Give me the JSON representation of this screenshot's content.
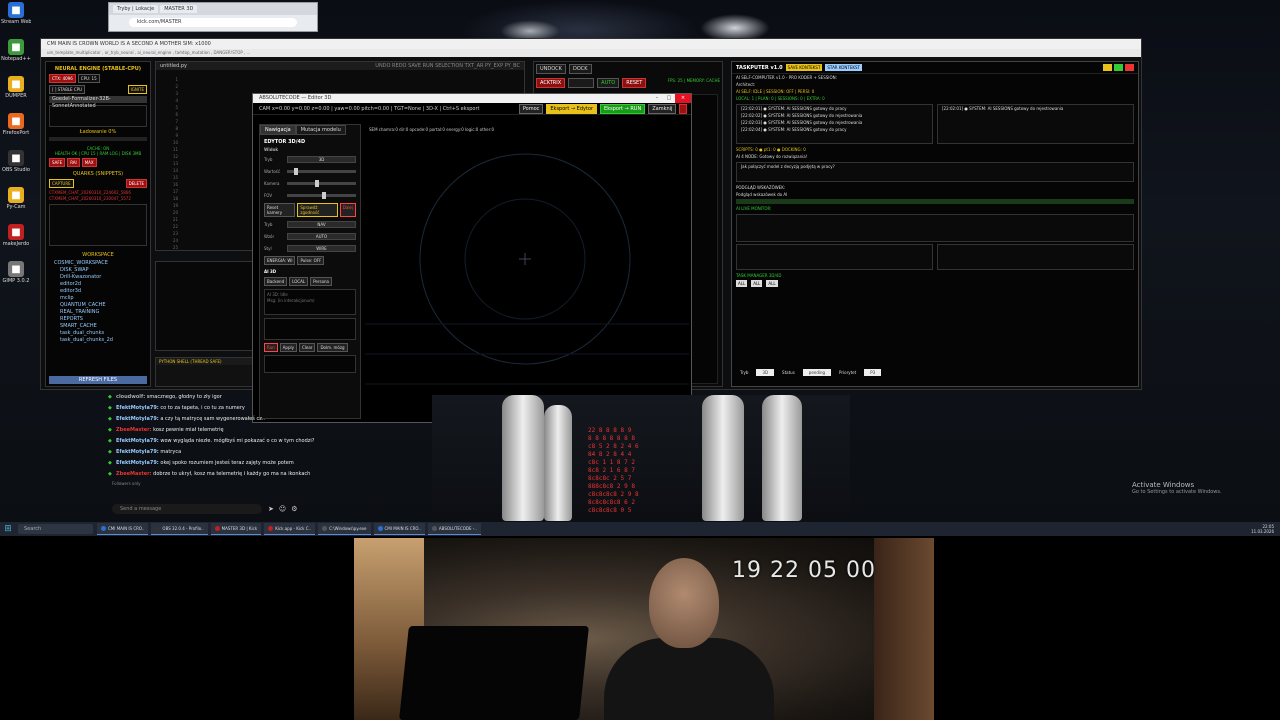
{
  "desktop_icons": [
    {
      "label": "Stream Webcam",
      "icon": "webcam-icon",
      "color": "#2a6fd6"
    },
    {
      "label": "Notepad++",
      "icon": "notepad-icon",
      "color": "#3c9a3c"
    },
    {
      "label": "DUMPER",
      "icon": "folder-icon",
      "color": "#e8b020"
    },
    {
      "label": "FirefoxPort",
      "icon": "firefox-icon",
      "color": "#e86a20"
    },
    {
      "label": "OBS Studio",
      "icon": "obs-icon",
      "color": "#333333"
    },
    {
      "label": "Py-Cam",
      "icon": "folder-icon",
      "color": "#e8b020"
    },
    {
      "label": "makeJerdo",
      "icon": "app-icon",
      "color": "#c02020"
    },
    {
      "label": "GIMP 3.0.2",
      "icon": "gimp-icon",
      "color": "#777777"
    }
  ],
  "browser": {
    "tabs": [
      "Tryby | Lokacje",
      "MASTER 3D"
    ],
    "url": "kick.com/MASTER"
  },
  "ide": {
    "title": "CMI MAIN IS CROWN WORLD IS A SECOND A MOTHER SIM: x1000",
    "subtitle": "um_template_multiplicator  ,  ar_tryb_neural  ,  ai_neural_engine  ,  tamtop_mutation  ,  DANGER!STOP  ,  ..."
  },
  "left_panel": {
    "title": "NEURAL ENGINE (STABLE-CPU)",
    "chips": [
      "CTX: 4096",
      "CPU: 15",
      "[ ] STABLE CPU",
      "IGNITE"
    ],
    "model": "Goedel-Formalizer-32B-SonnetAnnotated",
    "loading": "Ładowanie 0%",
    "cache": "CACHE: ON",
    "health": "HEALTH OK | CPU 15 | RAM LOG | DISK 3MB",
    "buttons": [
      "SAFE",
      "RAI",
      "MAX"
    ],
    "quarks_title": "QUARKS (SNIPPETS)",
    "capture": "CAPTURE",
    "delete": "DELETE",
    "snippets": [
      "CTXMEM_CHAT_20260310_224602_5866",
      "CTXMEM_CHAT_20260310_230047_5572"
    ],
    "workspace_title": "WORKSPACE",
    "tree": [
      "COSMIC_WORKSPACE",
      "DISK_SWAP",
      "Drill-Kwazonator",
      "editor2d",
      "editor3d",
      "mclip",
      "QUANTUM_CACHE",
      "REAL_TRAINING",
      "REPORTS",
      "SMART_CACHE",
      "task_dual_chunks",
      "task_dual_chunks_2d"
    ],
    "refresh": "REFRESH FILES"
  },
  "editor": {
    "tab": "untitled.py",
    "toolbar": "UNDO  REDO  SAVE  RUN  SELECTION  TXT_AR  PY_EXP  PY_BC",
    "lines": [
      "1",
      "2",
      "3",
      "4",
      "5",
      "6",
      "7",
      "8",
      "9",
      "10",
      "11",
      "12",
      "13",
      "14",
      "15",
      "16",
      "17",
      "18",
      "19",
      "20",
      "21",
      "22",
      "23",
      "24",
      "25"
    ],
    "shell_title": "PYTHON SHELL (THREAD SAFE)"
  },
  "right_mid": {
    "undock": "UNDOCK",
    "dock": "DOCK",
    "acktrix": "ACKTRIX",
    "auto": "AUTO",
    "reset": "RESET",
    "status": "FPS: 25 | MEMORY: CACHE"
  },
  "taskputer": {
    "title": "TASKPUTER v1.0",
    "pills": [
      "SAVE KONTEKST",
      "STAR KONTEKST"
    ],
    "header_line": "AI SELF-COMPUTER v1.0 - PRO KODER + SESSION:",
    "arch": "Architect:",
    "l1": "AI SELF: IDLE | SESSION: OFF | PERSI: 0",
    "l2": "LOCAL: 1 | PLAN: 0 | SESSIONS: 0 | EXTRA: 0",
    "log": [
      "[22:02:01] ● SYSTEM: AI SESSIONS gotowy do pracy",
      "[22:02:02] ● SYSTEM: AI SESSIONS gotowy do rejestrowania",
      "[22:02:03] ● SYSTEM: AI SESSIONS gotowy do rejestrowania",
      "[22:02:04] ● SYSTEM: AI SESSIONS gotowy do pracy"
    ],
    "right_log": "[22:02:01] ● SYSTEM: AI SESSIONS gotowy do rejestrowania",
    "q1": "SCRIPTS: 0  ●  pt1: 0  ●  DOCKING: 0",
    "q2": "AI 4 NODE: Gotowy do rozwiązania!",
    "q3": "Jak połączyć model z decyzją podjętą w pracy?",
    "q4": "PODGLĄD WSKAZÓWEK:",
    "q5": "Podgląd wskazówek do AI",
    "monitor": "AI LIVE MONITOR:",
    "bottom_selects": [
      "3D",
      "pending",
      "P3"
    ],
    "bottom_labels": [
      "Tryb",
      "Status",
      "Priorytet"
    ],
    "filters": [
      "ALL",
      "ALL",
      "ALL"
    ],
    "task_manager": "TASK MANAGER 3D/4D"
  },
  "editor3d": {
    "title": "ABSOLUTECODE — Editor 3D",
    "cam": "CAM x=0.00 y=0.00 z=0.00  |  yaw=0.00 pitch=0.00  |  TGT=None  |  3D-X  |  Ctrl+S eksport",
    "buttons": [
      "Pomoc",
      "Eksport → Edytor",
      "Eksport → RUN",
      "Zamknij"
    ],
    "tabs": [
      "Nawigacja",
      "Mutacja modelu"
    ],
    "hud": "SEM  chamra:0  dir:0  opcode:0  portal:0  energy:0  logic:0  other:0",
    "section": "EDYTOR 3D/4D",
    "subsection": "Widok",
    "rows": [
      {
        "k": "Tryb",
        "v": "3D"
      },
      {
        "k": "Wartość",
        "v": ""
      },
      {
        "k": "Kamera",
        "v": ""
      },
      {
        "k": "FOV",
        "v": ""
      }
    ],
    "reset": "Reset kamery",
    "check": "Sprawdź zgodność",
    "more": "Dalej",
    "rows2": [
      {
        "k": "Tryb",
        "v": "NAV"
      },
      {
        "k": "Wzór",
        "v": "AUTO"
      },
      {
        "k": "Styl",
        "v": "WIRE"
      }
    ],
    "energy": "ENERGIA: Wl",
    "pulse": "Pulse: OFF",
    "ai": "AI 3D",
    "backend": "Backend",
    "local": "LOCAL",
    "persona": "Persona",
    "log": "AI 3D: Idle\nMsg: (in interakcjonum)",
    "actions": [
      "Run",
      "Apply",
      "Clear",
      "Dolm. mózg"
    ]
  },
  "chat": [
    {
      "user": "cloudwolf:",
      "text": "smacznego, głodny to zły igor",
      "color": "gray"
    },
    {
      "user": "EfektMotyla79:",
      "text": "co to za tapeta, i co tu za numery",
      "color": "blue"
    },
    {
      "user": "EfektMotyla79:",
      "text": "a czy tą matrycę sam wygenerowałeś cz..",
      "color": "blue"
    },
    {
      "user": "ZbeeMaster:",
      "text": "kosz pewnie miał telemetrię",
      "color": "red"
    },
    {
      "user": "EfektMotyla79:",
      "text": "wow wygląda niezłe. mógłbyś mi pokazać o co w tym chodzi?",
      "color": "blue"
    },
    {
      "user": "EfektMotyla79:",
      "text": "matryca",
      "color": "blue"
    },
    {
      "user": "EfektMotyla79:",
      "text": "okej spoko rozumiem jesteś teraz zajęty może potem",
      "color": "blue"
    },
    {
      "user": "ZbeeMaster:",
      "text": "dobrze to ukrył, kosz ma telemetrię i każdy go ma na ikonkach",
      "color": "red"
    }
  ],
  "chat_footer": {
    "followers": "Followers only",
    "placeholder": "Send a message"
  },
  "matrix_lines": [
    "22 8 8 8 8 9",
    "8 8 8 8 8 8 8",
    "c8 5 2 8 2 4 6",
    "84 8 2 8 4 4",
    "c8c 1 1 8 7 2",
    "8c8 2 1 6 8 7",
    "8c8c8c 2 5 7",
    "888c8c8 2 9 8",
    "c8c8c8c8 2 9 8",
    "8c8c8c8c8 6 2",
    "c8c8c8c8 0 5"
  ],
  "activation": {
    "title": "Activate Windows",
    "sub": "Go to Settings to activate Windows."
  },
  "taskbar": {
    "search": "Search",
    "items": [
      {
        "label": "CMI MAIN IS CRO..",
        "color": "#2a6fd6"
      },
      {
        "label": "OBS 32.0.4 - Profilo..",
        "color": "#333333"
      },
      {
        "label": "MASTER 3D | Kick",
        "color": "#c02020"
      },
      {
        "label": "Kick.app - Kick C..",
        "color": "#c02020"
      },
      {
        "label": "C:\\Windows\\py.exe",
        "color": "#555555"
      },
      {
        "label": "CMI MAIN IS CRO..",
        "color": "#2a6fd6"
      },
      {
        "label": "ABSOLUTECODE -..",
        "color": "#555555"
      }
    ],
    "time": "22:05",
    "date": "11.03.2026"
  },
  "webcam": {
    "timestamp": "19 22 05 00"
  }
}
